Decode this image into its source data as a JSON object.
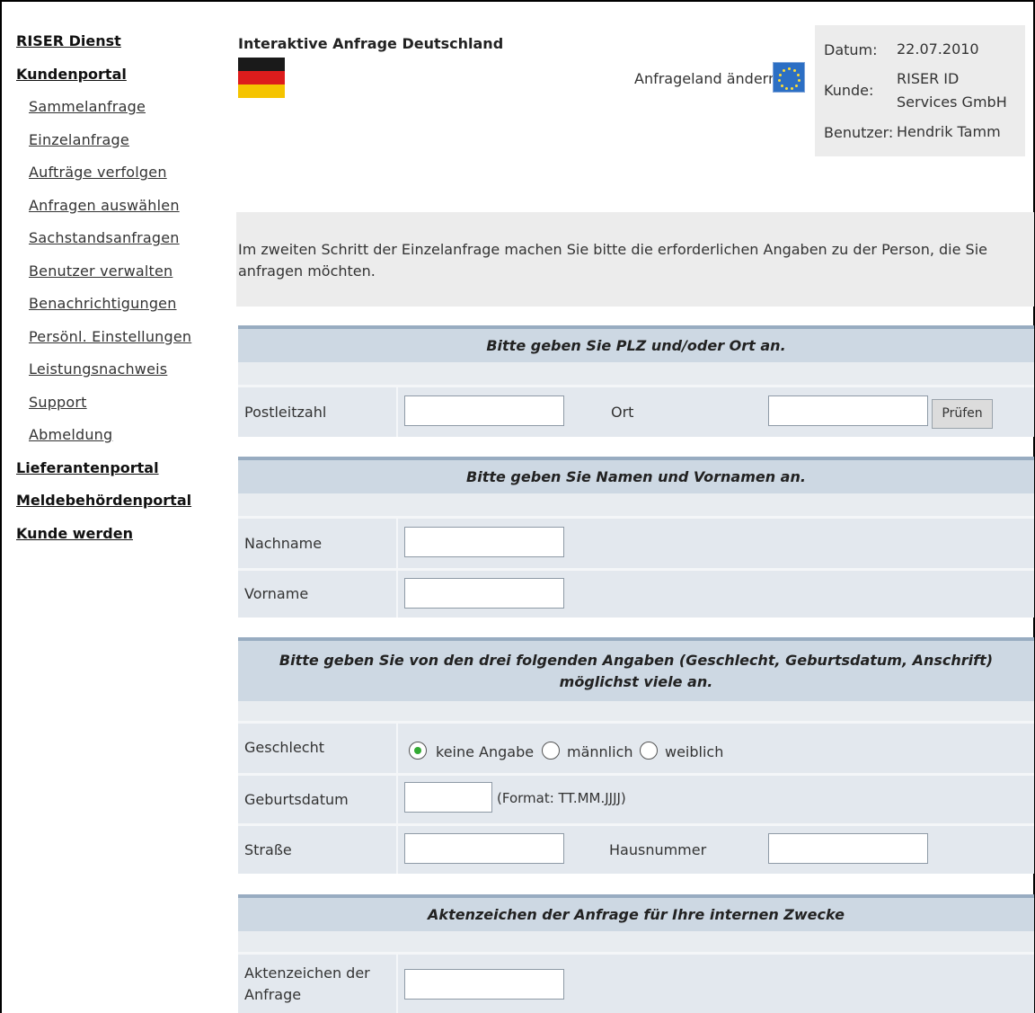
{
  "sidebar": {
    "riser_dienst": "RISER Dienst",
    "kundenportal": "Kundenportal",
    "sub_items": [
      "Sammelanfrage",
      "Einzelanfrage",
      "Aufträge verfolgen",
      "Anfragen auswählen",
      "Sachstandsanfragen",
      "Benutzer verwalten",
      "Benachrichtigungen",
      "Persönl. Einstellungen",
      "Leistungsnachweis",
      "Support",
      "Abmeldung"
    ],
    "lieferantenportal": "Lieferantenportal",
    "meldebehoerdenportal": "Meldebehördenportal",
    "kunde_werden": "Kunde werden"
  },
  "header": {
    "title": "Interaktive Anfrage Deutschland",
    "change_country": "Anfrageland ändern",
    "flag_colors": [
      "#1a1a1a",
      "#dd1c1c",
      "#f5c400"
    ],
    "eu_icon": "eu-flag-icon",
    "info": {
      "datum_label": "Datum:",
      "datum_value": "22.07.2010",
      "kunde_label": "Kunde:",
      "kunde_value_1": "RISER ID",
      "kunde_value_2": "Services GmbH",
      "benutzer_label": "Benutzer:",
      "benutzer_value": "Hendrik Tamm"
    }
  },
  "intro": "Im zweiten Schritt der Einzelanfrage machen Sie bitte die erforderlichen Angaben zu der Person, die Sie anfragen möchten.",
  "form": {
    "sec_plz": "Bitte geben Sie PLZ und/oder Ort an.",
    "plz_label": "Postleitzahl",
    "ort_label": "Ort",
    "pruefen_button": "Prüfen",
    "sec_name": "Bitte geben Sie Namen und Vornamen an.",
    "nachname_label": "Nachname",
    "vorname_label": "Vorname",
    "sec_details": "Bitte geben Sie von den drei folgenden Angaben (Geschlecht, Geburtsdatum, Anschrift) möglichst viele an.",
    "geschlecht_label": "Geschlecht",
    "gender_options": [
      "keine Angabe",
      "männlich",
      "weiblich"
    ],
    "gender_selected": "keine Angabe",
    "geburtsdatum_label": "Geburtsdatum",
    "date_format_hint": "(Format: TT.MM.JJJJ)",
    "strasse_label": "Straße",
    "hausnummer_label": "Hausnummer",
    "sec_aktenzeichen": "Aktenzeichen der Anfrage für Ihre internen Zwecke",
    "aktenzeichen_label_1": "Aktenzeichen der",
    "aktenzeichen_label_2": "Anfrage",
    "values": {
      "plz": "",
      "ort": "",
      "nachname": "",
      "vorname": "",
      "geburtsdatum": "",
      "strasse": "",
      "hausnummer": "",
      "aktenzeichen": ""
    }
  }
}
